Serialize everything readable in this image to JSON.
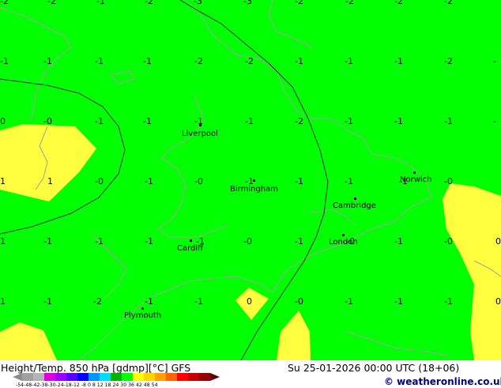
{
  "colors": {
    "green": "#00ff00",
    "yellow": "#ffff40",
    "coast": "#a0a0a0",
    "contour": "#303030",
    "scale": [
      "#8c8c8c",
      "#a0a0a0",
      "#b4b4b4",
      "#dc00dc",
      "#a000ff",
      "#5a00ff",
      "#0000ff",
      "#0096ff",
      "#00dcff",
      "#00b400",
      "#00ff00",
      "#ffff00",
      "#ffd200",
      "#ffa000",
      "#ff6400",
      "#ff0000",
      "#c80000",
      "#960000",
      "#5a0000"
    ]
  },
  "map_labels": [
    {
      "text": "-2"
    },
    {
      "text": "-2"
    },
    {
      "text": "-1"
    },
    {
      "text": "-2"
    },
    {
      "text": "-3"
    },
    {
      "text": "-3"
    },
    {
      "text": "-2"
    },
    {
      "text": "-2"
    },
    {
      "text": "-2"
    },
    {
      "text": "-2"
    },
    {
      "text": "-1"
    },
    {
      "text": "-1"
    },
    {
      "text": "-1"
    },
    {
      "text": "-1"
    },
    {
      "text": "-2"
    },
    {
      "text": "-2"
    },
    {
      "text": "-1"
    },
    {
      "text": "-1"
    },
    {
      "text": "-1"
    },
    {
      "text": "-2"
    },
    {
      "text": "-"
    },
    {
      "text": "0"
    },
    {
      "text": "-0"
    },
    {
      "text": "-1"
    },
    {
      "text": "-1"
    },
    {
      "text": "-1"
    },
    {
      "text": "-1"
    },
    {
      "text": "-2"
    },
    {
      "text": "-1"
    },
    {
      "text": "-1"
    },
    {
      "text": "-1"
    },
    {
      "text": "-"
    },
    {
      "text": "1"
    },
    {
      "text": "1"
    },
    {
      "text": "-0"
    },
    {
      "text": "-1"
    },
    {
      "text": "-0"
    },
    {
      "text": "-1"
    },
    {
      "text": "-1"
    },
    {
      "text": "-1"
    },
    {
      "text": "-1"
    },
    {
      "text": "-0"
    },
    {
      "text": "1"
    },
    {
      "text": "-1"
    },
    {
      "text": "-1"
    },
    {
      "text": "-1"
    },
    {
      "text": "-1"
    },
    {
      "text": "-0"
    },
    {
      "text": "-1"
    },
    {
      "text": "-0"
    },
    {
      "text": "-1"
    },
    {
      "text": "-0"
    },
    {
      "text": "0"
    },
    {
      "text": "1"
    },
    {
      "text": "-1"
    },
    {
      "text": "-2"
    },
    {
      "text": "-1"
    },
    {
      "text": "-1"
    },
    {
      "text": "0"
    },
    {
      "text": "-0"
    },
    {
      "text": "-1"
    },
    {
      "text": "-1"
    },
    {
      "text": "-1"
    },
    {
      "text": "0"
    }
  ],
  "cities": [
    {
      "name": "Liverpool"
    },
    {
      "name": "Birmingham"
    },
    {
      "name": "Cambridge"
    },
    {
      "name": "Norwich"
    },
    {
      "name": "Cardiff"
    },
    {
      "name": "London"
    },
    {
      "name": "Plymouth"
    }
  ],
  "footer": {
    "title": "Height/Temp. 850 hPa [gdmp][°C] GFS",
    "datetime": "Su 25-01-2026 00:00 UTC (18+06)",
    "copyright": "© weatheronline.co.uk",
    "scale_ticks": "-54-48-42-38-30-24-18-12 -8  0  8  12 18  24  30  36  42  48  54"
  }
}
